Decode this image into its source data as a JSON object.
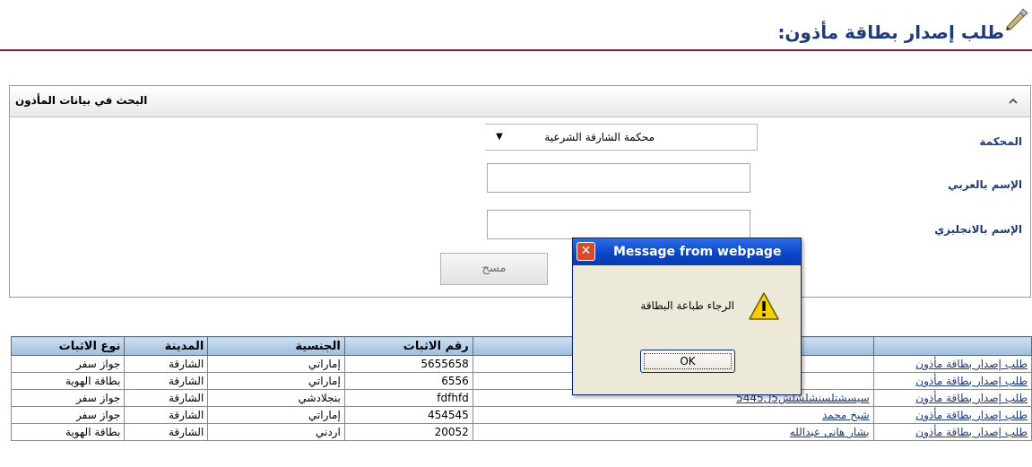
{
  "page": {
    "title": "طلب إصدار بطاقة مأذون:"
  },
  "search_panel": {
    "title": "البحث في بيانات المأذون",
    "court_label": "المحكمة",
    "court_value": "محكمة الشارقة الشرعية",
    "arabic_name_label": "الإسم بالعربي",
    "arabic_name_value": "",
    "english_name_label": "الإسم بالانجليزي",
    "english_name_value": "",
    "clear_button": "مسح"
  },
  "table": {
    "headers": [
      "",
      "",
      "رقم الاثبات",
      "الجنسية",
      "المدينة",
      "نوع الاثبات"
    ],
    "rows": [
      {
        "action": "طلب إصدار بطاقة مأذون",
        "name": "",
        "id_number": "5655658",
        "nationality": "إماراتي",
        "city": "الشارقة",
        "id_type": "جواز سفر"
      },
      {
        "action": "طلب إصدار بطاقة مأذون",
        "name": "",
        "id_number": "6556",
        "nationality": "إماراتي",
        "city": "الشارقة",
        "id_type": "بطاقة الهوية"
      },
      {
        "action": "طلب إصدار بطاقة مأذون",
        "name": "سيسشتلسنشلشلش5ل5445",
        "id_number": "fdfhfd",
        "nationality": "بنجلادشي",
        "city": "الشارقة",
        "id_type": "جواز سفر"
      },
      {
        "action": "طلب إصدار بطاقة مأذون",
        "name": "شيخ محمد",
        "id_number": "454545",
        "nationality": "إماراتي",
        "city": "الشارقة",
        "id_type": "جواز سفر"
      },
      {
        "action": "طلب إصدار بطاقة مأذون",
        "name": "بشار هاني عبدالله",
        "id_number": "20052",
        "nationality": "اردني",
        "city": "الشارقة",
        "id_type": "بطاقة الهوية"
      }
    ]
  },
  "dialog": {
    "title": "Message from webpage",
    "message": "الرجاء طباعة البطاقة",
    "ok": "OK"
  },
  "colors": {
    "title_text": "#1e3a78",
    "rule": "#8b2235",
    "table_header": "#9ebedf",
    "dialog_titlebar": "#0a46c8",
    "dialog_body": "#ece9d8"
  },
  "icons": [
    "pen-icon",
    "chevron-up-icon",
    "dropdown-arrow-icon",
    "close-icon",
    "warning-icon"
  ]
}
